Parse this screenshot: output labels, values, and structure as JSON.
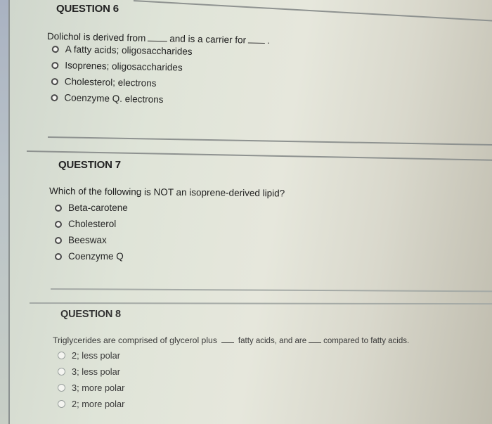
{
  "questions": [
    {
      "title": "QUESTION 6",
      "text_parts": [
        "Dolichol is derived from",
        "and is a carrier for",
        "."
      ],
      "options": [
        "A fatty acids; oligosaccharides",
        "Isoprenes; oligosaccharides",
        "Cholesterol; electrons",
        "Coenzyme Q. electrons"
      ],
      "selected": null
    },
    {
      "title": "QUESTION 7",
      "text": "Which of the following is NOT an isoprene-derived lipid?",
      "options": [
        "Beta-carotene",
        "Cholesterol",
        "Beeswax",
        "Coenzyme Q"
      ],
      "selected": null
    },
    {
      "title": "QUESTION 8",
      "text_parts": [
        "Triglycerides are comprised of glycerol plus",
        "fatty acids, and are",
        "compared to fatty acids."
      ],
      "options": [
        "2; less polar",
        "3; less polar",
        "3; more polar",
        "2; more polar"
      ],
      "selected": null
    }
  ]
}
